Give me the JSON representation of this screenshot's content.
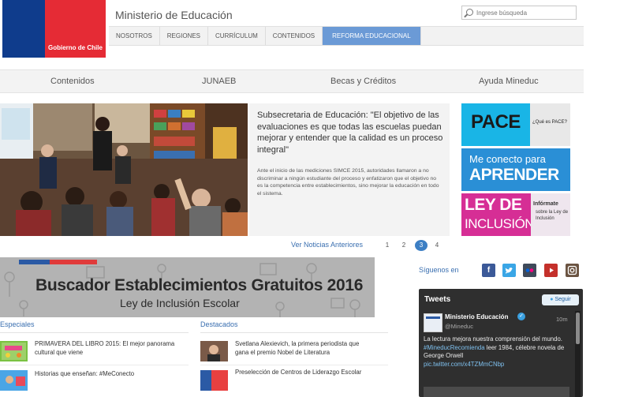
{
  "header": {
    "logo_text": "Gobierno de Chile",
    "ministry_title": "Ministerio de Educación",
    "search_placeholder": "Ingrese búsqueda"
  },
  "main_nav": [
    {
      "label": "NOSOTROS",
      "active": false
    },
    {
      "label": "REGIONES",
      "active": false
    },
    {
      "label": "CURRÍCULUM",
      "active": false
    },
    {
      "label": "CONTENIDOS",
      "active": false
    },
    {
      "label": "REFORMA EDUCACIONAL",
      "active": true
    }
  ],
  "secondary_nav": [
    "Contenidos",
    "JUNAEB",
    "Becas y Créditos",
    "Ayuda Mineduc"
  ],
  "hero": {
    "title": "Subsecretaria de Educación: \"El objetivo de las evaluaciones es que todas las escuelas puedan mejorar y entender que la calidad es un proceso integral\"",
    "body": "Ante el inicio de las mediciones SIMCE 2015, autoridades llamaron a no discriminar a ningún estudiante del proceso y enfatizaron que el objetivo no es la competencia entre establecimientos, sino mejorar la educación en todo el sistema."
  },
  "pager": {
    "prev_label": "Ver Noticias Anteriores",
    "pages": [
      "1",
      "2",
      "3",
      "4"
    ],
    "current": "3"
  },
  "promos": {
    "pace": {
      "big": "PACE",
      "small": "¿Qué es PACE?"
    },
    "aprender": {
      "line1": "Me conecto para",
      "line2": "APRENDER"
    },
    "ley": {
      "line1": "LEY DE",
      "line2": "INCLUSIÓN",
      "small_bold": "Infórmate",
      "small": "sobre la Ley de Inclusión"
    }
  },
  "banner": {
    "title": "Buscador Establecimientos Gratuitos 2016",
    "subtitle": "Ley de Inclusión Escolar"
  },
  "social": {
    "label": "Síguenos en",
    "icons": [
      "facebook-icon",
      "twitter-icon",
      "flickr-icon",
      "youtube-icon",
      "instagram-icon"
    ]
  },
  "especiales": {
    "heading": "Especiales",
    "items": [
      {
        "title": "PRIMAVERA DEL LIBRO 2015: El mejor panorama cultural que viene"
      },
      {
        "title": "Historias que enseñan: #MeConecto"
      }
    ]
  },
  "destacados": {
    "heading": "Destacados",
    "items": [
      {
        "title": "Svetlana Alexievich, la primera periodista que gana el premio Nobel de Literatura"
      },
      {
        "title": "Preselección de Centros de Liderazgo Escolar"
      }
    ]
  },
  "tweets": {
    "header": "Tweets",
    "follow_label": "Seguir",
    "name": "Ministerio Educación",
    "handle": "@Mineduc",
    "time": "10m",
    "text_line1": "La lectura mejora nuestra comprensión del mundo.",
    "hashtag": "#MineducRecomienda",
    "text_line2": " leer 1984, célebre novela de George Orwell",
    "link": "pic.twitter.com/x4TZMmCNbp"
  }
}
